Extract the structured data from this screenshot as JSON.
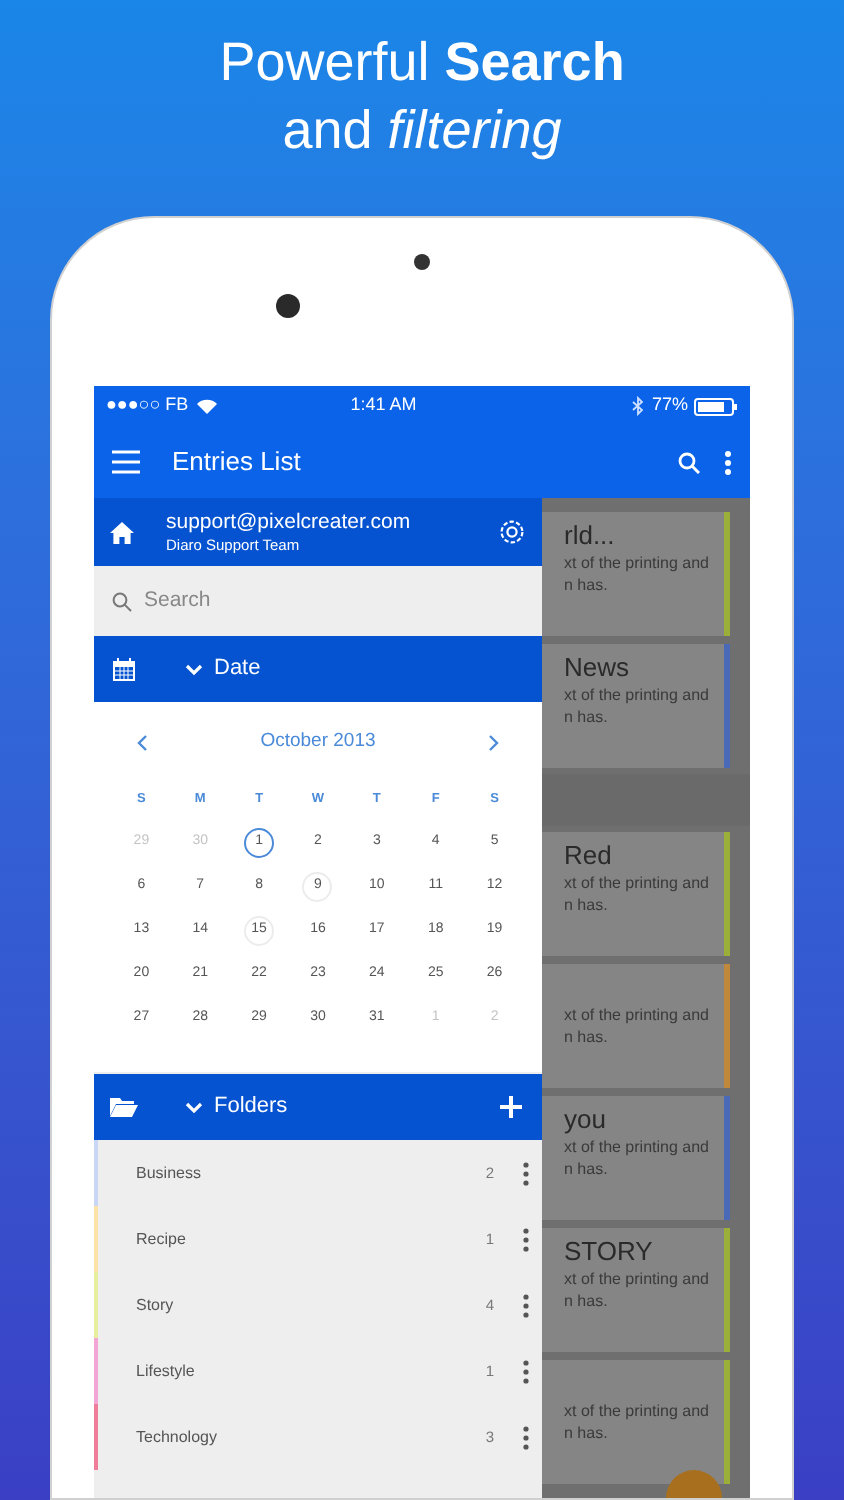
{
  "headline": [
    "Powerful **Search**",
    "and *filtering*"
  ],
  "status_bar": {
    "carrier": "●●●○○ FB",
    "time": "1:41 AM",
    "battery": "77%"
  },
  "toolbar": {
    "title": "Entries List"
  },
  "entries": [
    {
      "title": "rld...",
      "snippet": [
        "xt of the printing and",
        "n has."
      ],
      "color": "#9aae3a"
    },
    {
      "title": "News",
      "snippet": [
        "xt of the printing and",
        "n has."
      ],
      "color": "#4a6ab8"
    },
    {
      "kind": "gap"
    },
    {
      "title": "Red",
      "snippet": [
        "xt of the printing and",
        "n has."
      ],
      "color": "#9aae3a"
    },
    {
      "snippet": [
        "xt of the printing and",
        "n has."
      ],
      "color": "#c0883a"
    },
    {
      "title": "you",
      "snippet": [
        "xt of the printing and",
        "n has."
      ],
      "color": "#4a6ab8"
    },
    {
      "title": "STORY",
      "snippet": [
        "xt of the printing and",
        "n has."
      ],
      "color": "#9aae3a"
    },
    {
      "snippet": [
        "xt of the printing and",
        "n has."
      ],
      "color": "#9aae3a"
    }
  ],
  "drawer": {
    "account": {
      "email": "support@pixelcreater.com",
      "name": "Diaro Support Team"
    },
    "search": {
      "placeholder": "Search"
    },
    "date_section": {
      "title": "Date",
      "expanded": true
    },
    "calendar": {
      "month": "October 2013",
      "weekdays": [
        "S",
        "M",
        "T",
        "W",
        "T",
        "F",
        "S"
      ],
      "weeks": [
        [
          {
            "d": "29",
            "muted": true
          },
          {
            "d": "30",
            "muted": true
          },
          {
            "d": "1",
            "today": true
          },
          {
            "d": "2"
          },
          {
            "d": "3"
          },
          {
            "d": "4"
          },
          {
            "d": "5"
          }
        ],
        [
          {
            "d": "6"
          },
          {
            "d": "7"
          },
          {
            "d": "8"
          },
          {
            "d": "9",
            "marked": true
          },
          {
            "d": "10"
          },
          {
            "d": "11"
          },
          {
            "d": "12"
          }
        ],
        [
          {
            "d": "13"
          },
          {
            "d": "14"
          },
          {
            "d": "15",
            "marked": true
          },
          {
            "d": "16"
          },
          {
            "d": "17"
          },
          {
            "d": "18"
          },
          {
            "d": "19"
          }
        ],
        [
          {
            "d": "20"
          },
          {
            "d": "21"
          },
          {
            "d": "22"
          },
          {
            "d": "23"
          },
          {
            "d": "24"
          },
          {
            "d": "25"
          },
          {
            "d": "26"
          }
        ],
        [
          {
            "d": "27"
          },
          {
            "d": "28"
          },
          {
            "d": "29"
          },
          {
            "d": "30"
          },
          {
            "d": "31"
          },
          {
            "d": "1",
            "muted": true
          },
          {
            "d": "2",
            "muted": true
          }
        ]
      ]
    },
    "folders_section": {
      "title": "Folders",
      "expanded": true
    },
    "folders": [
      {
        "name": "Business",
        "count": "2",
        "color": "#c9d6f5"
      },
      {
        "name": "Recipe",
        "count": "1",
        "color": "#fbe3a8"
      },
      {
        "name": "Story",
        "count": "4",
        "color": "#e6ef9e"
      },
      {
        "name": "Lifestyle",
        "count": "1",
        "color": "#f3a6d6"
      },
      {
        "name": "Technology",
        "count": "3",
        "color": "#ef7d9a"
      }
    ]
  }
}
